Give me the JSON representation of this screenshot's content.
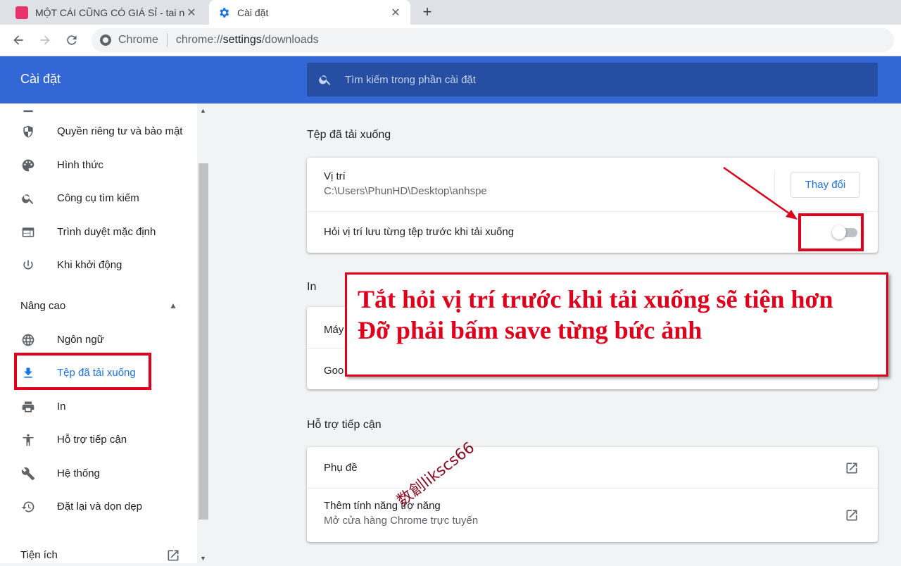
{
  "tabs": [
    {
      "title": "MỘT CÁI CŨNG CÓ GIÁ SỈ - tai ng",
      "favicon_color": "#e8326b",
      "active": false
    },
    {
      "title": "Cài đặt",
      "favicon": "gear-icon",
      "active": true
    }
  ],
  "toolbar": {
    "omnibox_label": "Chrome",
    "url_scheme": "chrome://",
    "url_host": "settings",
    "url_path": "/downloads"
  },
  "header": {
    "title": "Cài đặt",
    "search_placeholder": "Tìm kiếm trong phần cài đặt"
  },
  "sidebar": {
    "items": [
      {
        "label": "Quyền riêng tư và bảo mật",
        "icon": "shield-icon"
      },
      {
        "label": "Hình thức",
        "icon": "palette-icon"
      },
      {
        "label": "Công cụ tìm kiếm",
        "icon": "search-icon"
      },
      {
        "label": "Trình duyệt mặc định",
        "icon": "browser-icon"
      },
      {
        "label": "Khi khởi động",
        "icon": "power-icon"
      }
    ],
    "advanced_label": "Nâng cao",
    "advanced_items": [
      {
        "label": "Ngôn ngữ",
        "icon": "globe-icon"
      },
      {
        "label": "Tệp đã tải xuống",
        "icon": "download-icon",
        "active": true
      },
      {
        "label": "In",
        "icon": "printer-icon"
      },
      {
        "label": "Hỗ trợ tiếp cận",
        "icon": "accessibility-icon"
      },
      {
        "label": "Hệ thống",
        "icon": "wrench-icon"
      },
      {
        "label": "Đặt lại và dọn dẹp",
        "icon": "restore-icon"
      }
    ],
    "extensions_label": "Tiện ích"
  },
  "downloads": {
    "section_title": "Tệp đã tải xuống",
    "location_label": "Vị trí",
    "location_value": "C:\\Users\\PhunHD\\Desktop\\anhspe",
    "change_button": "Thay đổi",
    "ask_label": "Hỏi vị trí lưu từng tệp trước khi tải xuống",
    "ask_enabled": false
  },
  "printing": {
    "section_title": "In",
    "row1_partial": "Máy",
    "row2_partial": "Goo"
  },
  "accessibility": {
    "section_title": "Hỗ trợ tiếp cận",
    "captions_label": "Phụ đề",
    "add_features_label": "Thêm tính năng trợ năng",
    "add_features_sub": "Mở cửa hàng Chrome trực tuyến"
  },
  "annotation": {
    "line1": "Tắt hỏi vị trí trước khi tải xuống sẽ tiện hơn",
    "line2": "Đỡ phải bấm save từng bức ảnh",
    "color": "#e0001b"
  },
  "watermark": "数創likscs66",
  "colors": {
    "header_blue": "#3367d6",
    "search_blue": "#264ea3",
    "accent": "#1a73e8",
    "annotation_red": "#e0001b"
  }
}
